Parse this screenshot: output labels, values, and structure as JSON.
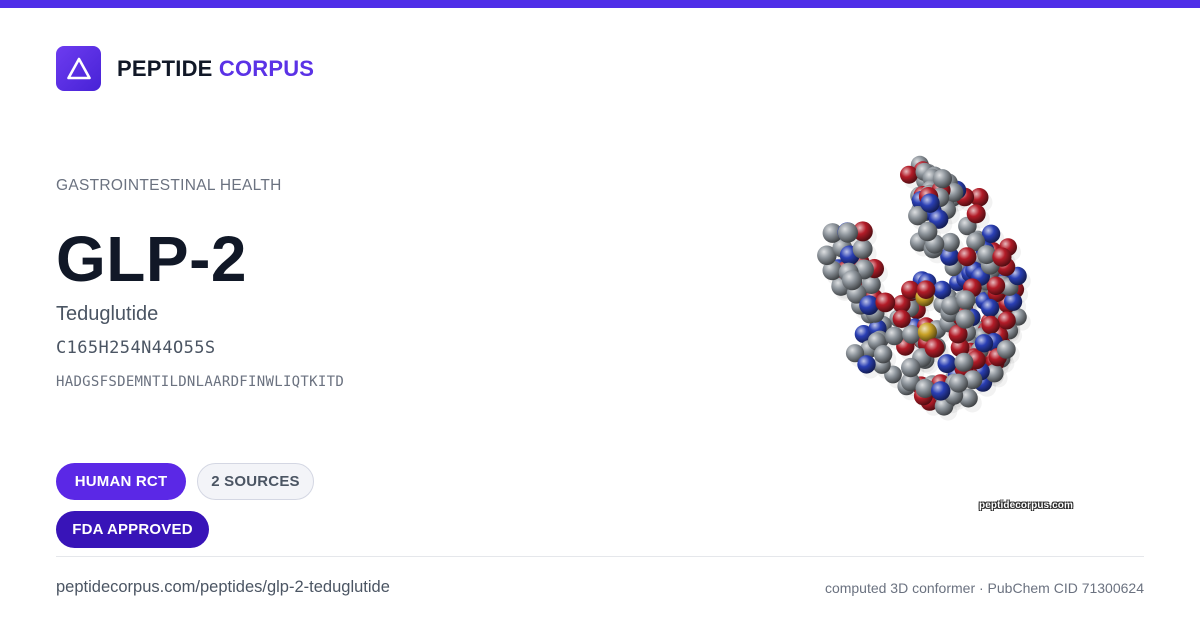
{
  "brand": {
    "name": "PEPTIDE",
    "accent": "CORPUS",
    "accent_color": "#5b32e6",
    "logo_icon": "triangle-icon"
  },
  "colors": {
    "top_bar": "#4f2ee8",
    "rct_badge": "#5b28e6",
    "fda_badge": "#3814b8"
  },
  "peptide": {
    "category": "GASTROINTESTINAL HEALTH",
    "name": "GLP-2",
    "drug_name": "Teduglutide",
    "formula": "C165H254N44O55S",
    "sequence": "HADGSFSDEMNTILDNLAARDFINWLIQTKITD"
  },
  "badges": {
    "rct": "HUMAN RCT",
    "sources": "2 SOURCES",
    "fda": "FDA APPROVED"
  },
  "molecule": {
    "watermark": "peptidecorpus.com",
    "atom_colors": {
      "C": "#8e959c",
      "O": "#b31c28",
      "N": "#2a3fb4",
      "S": "#c9a227"
    }
  },
  "footer": {
    "url": "peptidecorpus.com/peptides/glp-2-teduglutide",
    "source": "computed 3D conformer · PubChem CID 71300624"
  }
}
